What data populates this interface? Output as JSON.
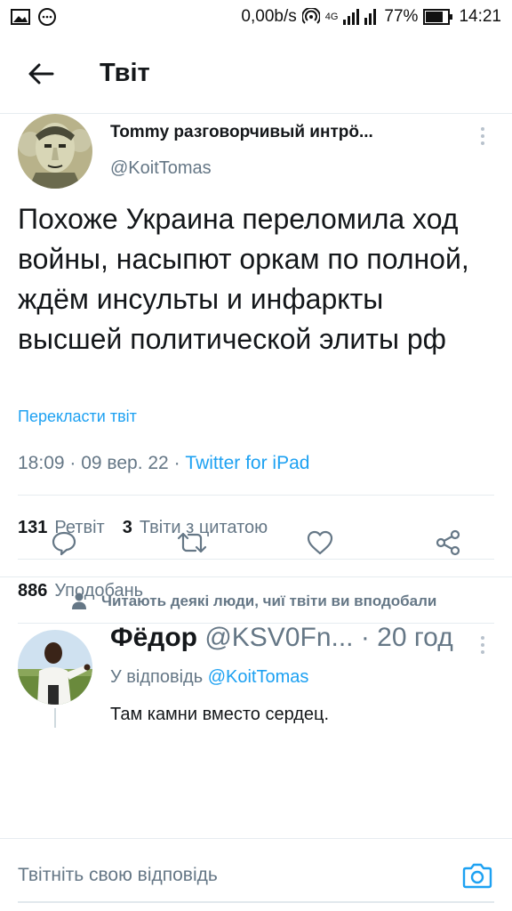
{
  "status_bar": {
    "speed": "0,00b/s",
    "network": "4G",
    "battery": "77%",
    "time": "14:21",
    "icons": [
      "image-icon",
      "chat-bubble-icon",
      "hotspot-icon",
      "signal-icon",
      "battery-icon"
    ]
  },
  "header": {
    "back_icon": "arrow-left-icon",
    "title": "Твіт"
  },
  "tweet": {
    "author_name": "Tommy разговорчивый интрö...",
    "author_handle": "@KoitTomas",
    "text": "Похоже Украина переломила ход войны, насыпют оркам по полной, ждём инсульты и инфаркты высшей политической элиты рф",
    "translate_label": "Перекласти твіт",
    "time": "18:09",
    "date": "09 вер. 22",
    "source": "Twitter for iPad",
    "retweets_count": "131",
    "retweets_label": "Ретвіт",
    "quotes_count": "3",
    "quotes_label": "Твіти з цитатою",
    "likes_count": "886",
    "likes_label": "Уподобань"
  },
  "actions": [
    "reply-icon",
    "retweet-icon",
    "like-icon",
    "share-icon"
  ],
  "reply": {
    "context_label": "Читають деякі люди, чиї твіти ви вподобали",
    "name": "Фёдор",
    "handle": "@KSV0Fn...",
    "time": "· 20 год",
    "reply_to_prefix": "У відповідь",
    "reply_to_handle": "@KoitTomas",
    "text": "Там камни вместо сердец."
  },
  "compose": {
    "placeholder": "Твітніть свою відповідь"
  },
  "colors": {
    "accent": "#1da1f2",
    "secondary_text": "#657786",
    "primary_text": "#14171a",
    "divider": "#e6ecf0"
  }
}
